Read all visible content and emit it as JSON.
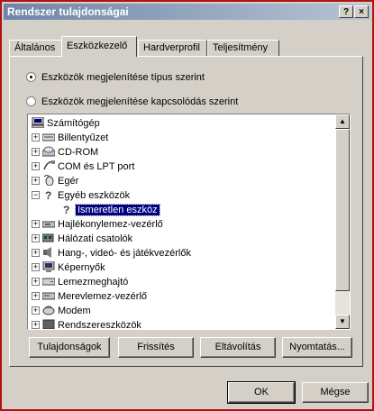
{
  "window": {
    "title": "Rendszer tulajdonságai",
    "help_label": "?",
    "close_label": "×"
  },
  "tabs": [
    {
      "label": "Általános"
    },
    {
      "label": "Eszközkezelő"
    },
    {
      "label": "Hardverprofil"
    },
    {
      "label": "Teljesítmény"
    }
  ],
  "view_options": {
    "by_type": {
      "label": "Eszközök megjelenítése típus szerint",
      "selected": true
    },
    "by_connection": {
      "label": "Eszközök megjelenítése kapcsolódás szerint",
      "selected": false
    }
  },
  "tree": {
    "root": {
      "label": "Számítógép",
      "icon": "computer-icon"
    },
    "items": [
      {
        "label": "Billentyűzet",
        "icon": "keyboard-icon",
        "expander": "+"
      },
      {
        "label": "CD-ROM",
        "icon": "cdrom-icon",
        "expander": "+"
      },
      {
        "label": "COM és LPT port",
        "icon": "port-icon",
        "expander": "+"
      },
      {
        "label": "Egér",
        "icon": "mouse-icon",
        "expander": "+"
      },
      {
        "label": "Egyéb eszközök",
        "icon": "question-icon",
        "expander": "−"
      },
      {
        "label": "Ismeretlen eszköz",
        "icon": "question-icon",
        "expander": "",
        "selected": true
      },
      {
        "label": "Hajlékonylemez-vezérlő",
        "icon": "floppy-controller-icon",
        "expander": "+"
      },
      {
        "label": "Hálózati csatolók",
        "icon": "network-adapter-icon",
        "expander": "+"
      },
      {
        "label": "Hang-, videó- és játékvezérlők",
        "icon": "sound-icon",
        "expander": "+"
      },
      {
        "label": "Képernyők",
        "icon": "monitor-icon",
        "expander": "+"
      },
      {
        "label": "Lemezmeghajtó",
        "icon": "disk-drive-icon",
        "expander": "+"
      },
      {
        "label": "Merevlemez-vezérlő",
        "icon": "hdd-controller-icon",
        "expander": "+"
      },
      {
        "label": "Modem",
        "icon": "modem-icon",
        "expander": "+"
      },
      {
        "label": "Rendszereszközök",
        "icon": "system-devices-icon",
        "expander": "+"
      }
    ]
  },
  "actions": {
    "properties": "Tulajdonságok",
    "refresh": "Frissítés",
    "remove": "Eltávolítás",
    "print": "Nyomtatás..."
  },
  "dialog": {
    "ok": "OK",
    "cancel": "Mégse"
  },
  "colors": {
    "title_bar_start": "#6f86a8",
    "title_bar_end": "#b7c3d4",
    "selection": "#000080",
    "frame": "#b11212"
  }
}
